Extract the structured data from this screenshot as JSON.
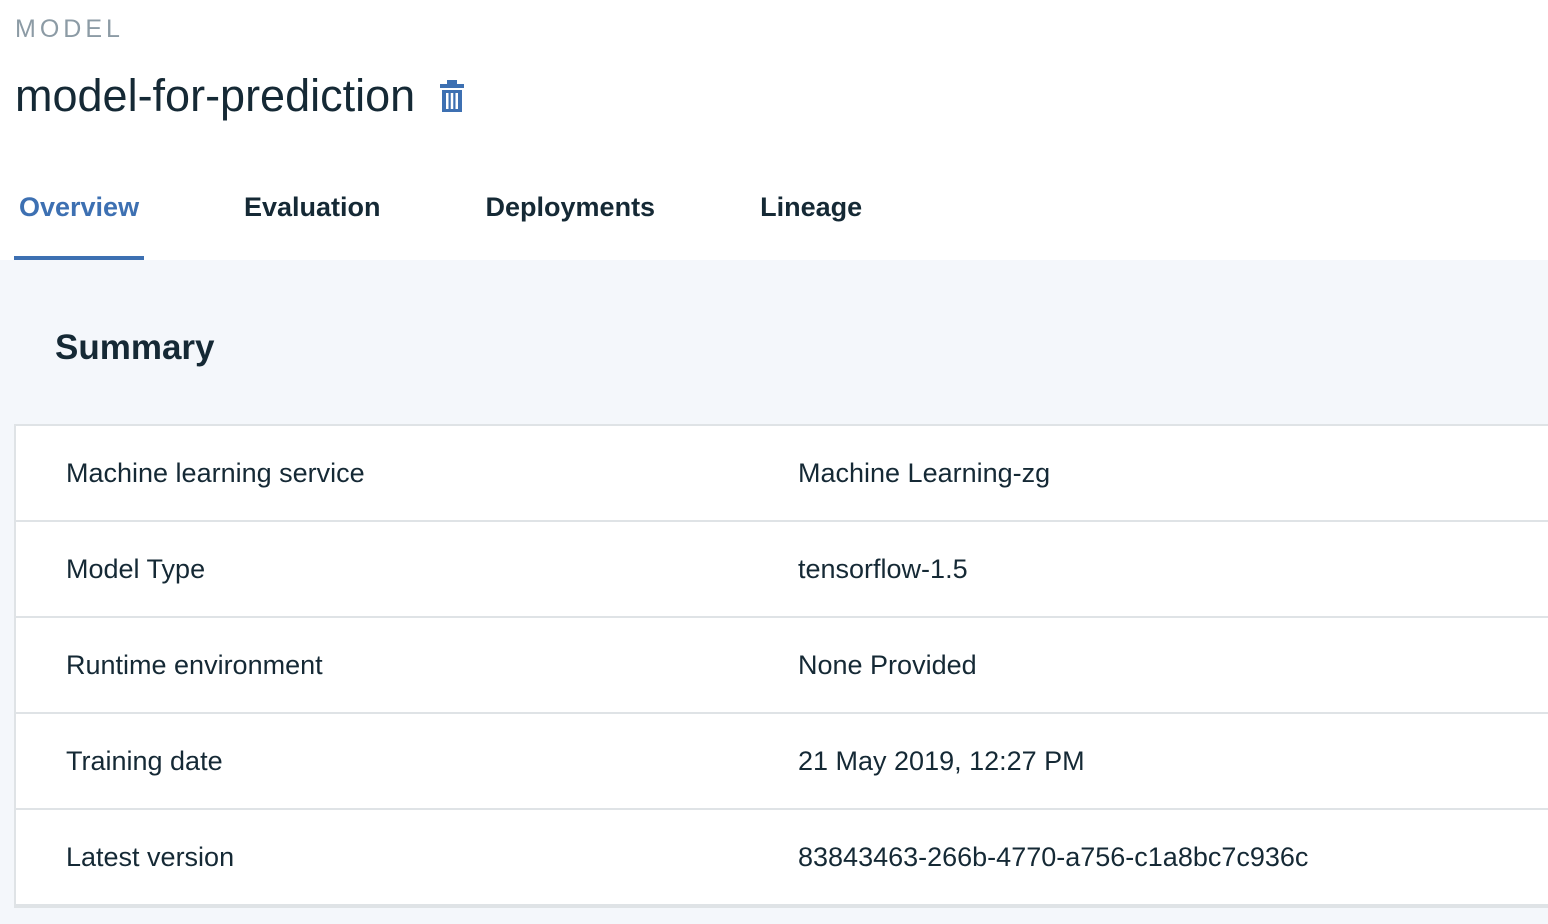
{
  "header": {
    "eyebrow": "MODEL",
    "title": "model-for-prediction",
    "delete_icon": "trash-icon"
  },
  "tabs": [
    {
      "label": "Overview",
      "active": true
    },
    {
      "label": "Evaluation",
      "active": false
    },
    {
      "label": "Deployments",
      "active": false
    },
    {
      "label": "Lineage",
      "active": false
    }
  ],
  "summary": {
    "title": "Summary",
    "rows": [
      {
        "key": "Machine learning service",
        "value": "Machine Learning-zg"
      },
      {
        "key": "Model Type",
        "value": "tensorflow-1.5"
      },
      {
        "key": "Runtime environment",
        "value": "None Provided"
      },
      {
        "key": "Training date",
        "value": "21 May 2019, 12:27 PM"
      },
      {
        "key": "Latest version",
        "value": "83843463-266b-4770-a756-c1a8bc7c936c"
      }
    ]
  },
  "colors": {
    "accent": "#3d70b2",
    "text": "#152935",
    "muted": "#8c9ba5",
    "panel_bg": "#f4f7fb",
    "border": "#dfe3e6"
  }
}
